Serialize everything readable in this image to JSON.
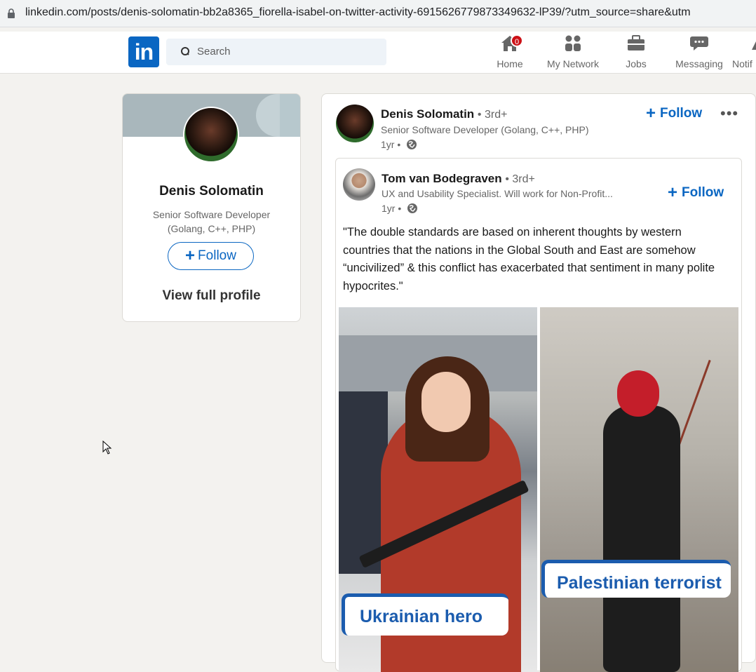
{
  "browser": {
    "url": "linkedin.com/posts/denis-solomatin-bb2a8365_fiorella-isabel-on-twitter-activity-6915626779873349632-lP39/?utm_source=share&utm"
  },
  "nav": {
    "logo_text": "in",
    "search_placeholder": "Search",
    "items": [
      {
        "label": "Home",
        "icon": "home-icon",
        "badge": "0"
      },
      {
        "label": "My Network",
        "icon": "network-icon"
      },
      {
        "label": "Jobs",
        "icon": "briefcase-icon"
      },
      {
        "label": "Messaging",
        "icon": "messaging-icon"
      },
      {
        "label": "Notif",
        "icon": "bell-icon"
      }
    ],
    "brand_color": "#0a66c2"
  },
  "profile_card": {
    "name": "Denis Solomatin",
    "title": "Senior Software Developer (Golang, C++, PHP)",
    "follow_label": "Follow",
    "view_profile_label": "View full profile"
  },
  "post": {
    "author": "Denis Solomatin",
    "degree": "• 3rd+",
    "headline": "Senior Software Developer (Golang, C++, PHP)",
    "time": "1yr •",
    "follow_label": "Follow",
    "more_label": "•••",
    "shared": {
      "author": "Tom van Bodegraven",
      "degree": "• 3rd+",
      "headline": "UX and Usability Specialist. Will work for Non-Profit...",
      "time": "1yr •",
      "follow_label": "Follow",
      "text": "\"The double standards are based on inherent thoughts by western countries that the nations in the Global South and East are somehow “uncivilized” & this conflict has exacerbated that sentiment in many polite hypocrites.\"",
      "images": [
        {
          "caption": "Ukrainian hero"
        },
        {
          "caption": "Palestinian terrorist"
        }
      ]
    }
  }
}
